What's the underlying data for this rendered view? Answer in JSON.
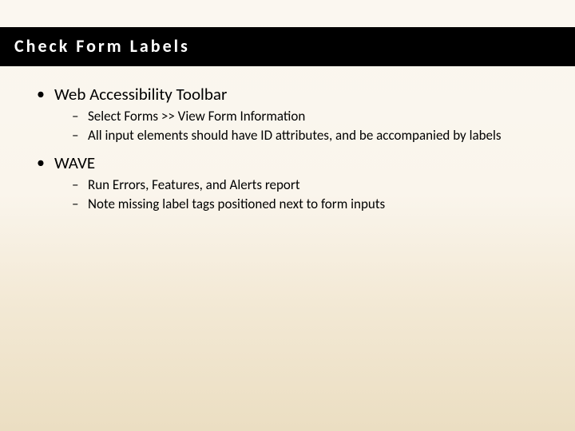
{
  "title": "Check Form Labels",
  "bullets": [
    {
      "text": "Web Accessibility Toolbar",
      "sub": [
        "Select Forms >> View Form Information",
        "All input elements should have ID attributes, and be accompanied by labels"
      ]
    },
    {
      "text": "WAVE",
      "sub": [
        "Run Errors, Features, and Alerts report",
        "Note missing label tags positioned next to form inputs"
      ]
    }
  ]
}
